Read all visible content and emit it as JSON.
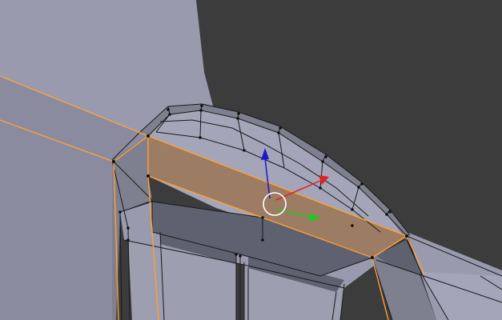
{
  "viewport": {
    "mode": "edit-mode",
    "background_color": "#3c3c3c",
    "colors": {
      "wall": "#999aae",
      "wall_light": "#a4a5b9",
      "wall_dark": "#8a8b9f",
      "frame_side": "#7f808f",
      "recess_dark": "#5e6170",
      "glass": "#9d9eb0",
      "selected_face": "#9c7c63",
      "selected_edge": "#ffa033",
      "edge": "#1a1a1a",
      "vertex": "#111111",
      "gizmo_x": "#e22020",
      "gizmo_y": "#25c425",
      "gizmo_z": "#1a1acc",
      "gizmo_circle": "#ffffff"
    }
  },
  "gizmo": {
    "axes": [
      "x",
      "y",
      "z"
    ]
  }
}
